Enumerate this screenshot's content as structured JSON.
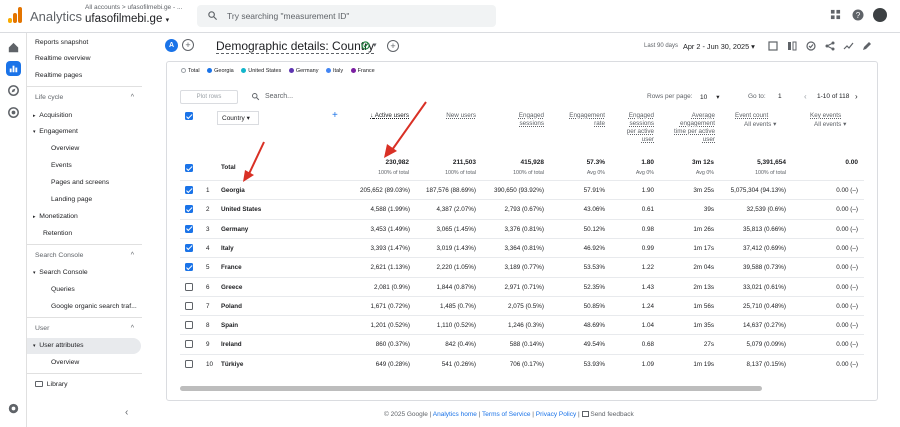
{
  "app": {
    "title": "Analytics",
    "breadcrumb": "All accounts > ufasofilmebi.ge - ...",
    "account_name": "ufasofilmebi.ge",
    "search_placeholder": "Try searching \"measurement ID\""
  },
  "sidebar": {
    "items": [
      {
        "label": "Reports snapshot"
      },
      {
        "label": "Realtime overview"
      },
      {
        "label": "Realtime pages"
      }
    ],
    "lifecycle": {
      "heading": "Life cycle",
      "acquisition": "Acquisition",
      "engagement": "Engagement",
      "engagement_items": [
        "Overview",
        "Events",
        "Pages and screens",
        "Landing page"
      ],
      "monetization": "Monetization",
      "retention": "Retention"
    },
    "search_console": {
      "heading": "Search Console",
      "group": "Search Console",
      "items": [
        "Queries",
        "Google organic search traf..."
      ]
    },
    "user": {
      "heading": "User",
      "group": "User attributes",
      "items": [
        "Overview"
      ]
    },
    "library": "Library"
  },
  "header": {
    "avatar_letter": "A",
    "page_title": "Demographic details: Country",
    "date_label": "Last 90 days",
    "date_range": "Apr 2 - Jun 30, 2025"
  },
  "legend": [
    "Total",
    "Georgia",
    "United States",
    "Germany",
    "Italy",
    "France"
  ],
  "legend_colors": [
    "#9aa0a6",
    "#1a73e8",
    "#12b5cb",
    "#5e35b1",
    "#4285f4",
    "#7b1fa2"
  ],
  "table_controls": {
    "plot_rows": "Plot rows",
    "search": "Search...",
    "rows_per_page_label": "Rows per page:",
    "rows_per_page": "10",
    "goto_label": "Go to:",
    "goto_value": "1",
    "page_info": "1-10 of 118"
  },
  "columns": {
    "dimension": "Country",
    "active_users": "Active users",
    "new_users": "New users",
    "engaged_sessions": "Engaged sessions",
    "engagement_rate": "Engagement rate",
    "engaged_per_user": "Engaged sessions per active user",
    "avg_time": "Average engagement time per active user",
    "event_count": "Event count",
    "event_sub": "All events",
    "key_events": "Key events",
    "key_sub": "All events"
  },
  "totals": {
    "label": "Total",
    "active_users": "230,982",
    "active_users_sub": "100% of total",
    "new_users": "211,503",
    "new_users_sub": "100% of total",
    "engaged_sessions": "415,928",
    "engaged_sessions_sub": "100% of total",
    "engagement_rate": "57.3%",
    "engagement_rate_sub": "Avg 0%",
    "engaged_per_user": "1.80",
    "engaged_per_user_sub": "Avg 0%",
    "avg_time": "3m 12s",
    "avg_time_sub": "Avg 0%",
    "event_count": "5,391,654",
    "event_count_sub": "100% of total",
    "key_events": "0.00"
  },
  "rows": [
    {
      "idx": "1",
      "country": "Georgia",
      "active": "205,652 (89.03%)",
      "new": "187,576 (88.69%)",
      "engaged": "390,650 (93.92%)",
      "rate": "57.91%",
      "per_user": "1.90",
      "time": "3m 25s",
      "events": "5,075,304 (94.13%)",
      "key": "0.00 (–)",
      "checked": true
    },
    {
      "idx": "2",
      "country": "United States",
      "active": "4,588 (1.99%)",
      "new": "4,387 (2.07%)",
      "engaged": "2,793 (0.67%)",
      "rate": "43.06%",
      "per_user": "0.61",
      "time": "39s",
      "events": "32,539 (0.6%)",
      "key": "0.00 (–)",
      "checked": true
    },
    {
      "idx": "3",
      "country": "Germany",
      "active": "3,453 (1.49%)",
      "new": "3,065 (1.45%)",
      "engaged": "3,376 (0.81%)",
      "rate": "50.12%",
      "per_user": "0.98",
      "time": "1m 26s",
      "events": "35,813 (0.66%)",
      "key": "0.00 (–)",
      "checked": true
    },
    {
      "idx": "4",
      "country": "Italy",
      "active": "3,393 (1.47%)",
      "new": "3,019 (1.43%)",
      "engaged": "3,364 (0.81%)",
      "rate": "46.92%",
      "per_user": "0.99",
      "time": "1m 17s",
      "events": "37,412 (0.69%)",
      "key": "0.00 (–)",
      "checked": true
    },
    {
      "idx": "5",
      "country": "France",
      "active": "2,621 (1.13%)",
      "new": "2,220 (1.05%)",
      "engaged": "3,189 (0.77%)",
      "rate": "53.53%",
      "per_user": "1.22",
      "time": "2m 04s",
      "events": "39,588 (0.73%)",
      "key": "0.00 (–)",
      "checked": true
    },
    {
      "idx": "6",
      "country": "Greece",
      "active": "2,081 (0.9%)",
      "new": "1,844 (0.87%)",
      "engaged": "2,971 (0.71%)",
      "rate": "52.35%",
      "per_user": "1.43",
      "time": "2m 13s",
      "events": "33,021 (0.61%)",
      "key": "0.00 (–)",
      "checked": false
    },
    {
      "idx": "7",
      "country": "Poland",
      "active": "1,671 (0.72%)",
      "new": "1,485 (0.7%)",
      "engaged": "2,075 (0.5%)",
      "rate": "50.85%",
      "per_user": "1.24",
      "time": "1m 56s",
      "events": "25,710 (0.48%)",
      "key": "0.00 (–)",
      "checked": false
    },
    {
      "idx": "8",
      "country": "Spain",
      "active": "1,201 (0.52%)",
      "new": "1,110 (0.52%)",
      "engaged": "1,246 (0.3%)",
      "rate": "48.69%",
      "per_user": "1.04",
      "time": "1m 35s",
      "events": "14,637 (0.27%)",
      "key": "0.00 (–)",
      "checked": false
    },
    {
      "idx": "9",
      "country": "Ireland",
      "active": "860 (0.37%)",
      "new": "842 (0.4%)",
      "engaged": "588 (0.14%)",
      "rate": "49.54%",
      "per_user": "0.68",
      "time": "27s",
      "events": "5,079 (0.09%)",
      "key": "0.00 (–)",
      "checked": false
    },
    {
      "idx": "10",
      "country": "Türkiye",
      "active": "649 (0.28%)",
      "new": "541 (0.26%)",
      "engaged": "706 (0.17%)",
      "rate": "53.93%",
      "per_user": "1.09",
      "time": "1m 19s",
      "events": "8,137 (0.15%)",
      "key": "0.00 (–)",
      "checked": false
    }
  ],
  "footer": {
    "copyright": "© 2025 Google |",
    "analytics_home": "Analytics home",
    "terms": "Terms of Service",
    "privacy": "Privacy Policy",
    "feedback": "Send feedback"
  }
}
